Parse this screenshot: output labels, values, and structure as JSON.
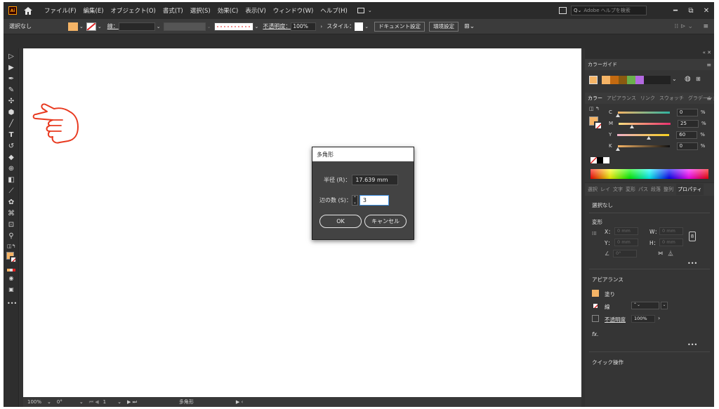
{
  "menubar": {
    "logo": "Ai",
    "items": [
      "ファイル(F)",
      "編集(E)",
      "オブジェクト(O)",
      "書式(T)",
      "選択(S)",
      "効果(C)",
      "表示(V)",
      "ウィンドウ(W)",
      "ヘルプ(H)"
    ],
    "search_placeholder": "Adobe ヘルプを検索",
    "win_min": "━",
    "win_restore": "⧉",
    "win_close": "✕"
  },
  "controlbar": {
    "selection": "選択なし",
    "stroke_label": "線：",
    "opacity_label": "不透明度：",
    "opacity_value": "100%",
    "style_label": "スタイル：",
    "doc_setup": "ドキュメント設定",
    "prefs": "環境設定",
    "fill_color": "#f5b466"
  },
  "dialog": {
    "title": "多角形",
    "radius_label": "半径 (R)：",
    "radius_value": "17.639 mm",
    "sides_label": "辺の数 (S)：",
    "sides_value": "3",
    "ok": "OK",
    "cancel": "キャンセル"
  },
  "status": {
    "zoom": "100%",
    "rotation": "0°",
    "artboard": "1",
    "tool": "多角形"
  },
  "color_guide": {
    "title": "カラーガイド"
  },
  "color_panel": {
    "tabs": [
      "カラー",
      "アピアランス",
      "リンク",
      "スウォッチ",
      "グラデーション"
    ],
    "channels": [
      {
        "label": "C",
        "value": "0",
        "unit": "%",
        "pos": 0.0
      },
      {
        "label": "M",
        "value": "25",
        "unit": "%",
        "pos": 0.25
      },
      {
        "label": "Y",
        "value": "60",
        "unit": "%",
        "pos": 0.6
      },
      {
        "label": "K",
        "value": "0",
        "unit": "%",
        "pos": 0.0
      }
    ]
  },
  "properties": {
    "tabs": [
      "選択",
      "レイ",
      "文字",
      "変形",
      "パス",
      "段落",
      "整列",
      "プロパティ"
    ],
    "selection": "選択なし",
    "transform_title": "変形",
    "x_label": "X：",
    "y_label": "Y：",
    "w_label": "W：",
    "h_label": "H：",
    "x_value": "0 mm",
    "y_value": "0 mm",
    "w_value": "0 mm",
    "h_value": "0 mm",
    "angle_value": "0°",
    "appearance_title": "アピアランス",
    "fill_label": "塗り",
    "stroke_label": "線",
    "opacity_label": "不透明度",
    "opacity_value": "100%",
    "fx_label": "fx.",
    "quick_actions": "クイック操作"
  },
  "colors": {
    "ui_dark": "#323232",
    "accent_orange": "#f5b466",
    "hand_red": "#e8391f"
  }
}
